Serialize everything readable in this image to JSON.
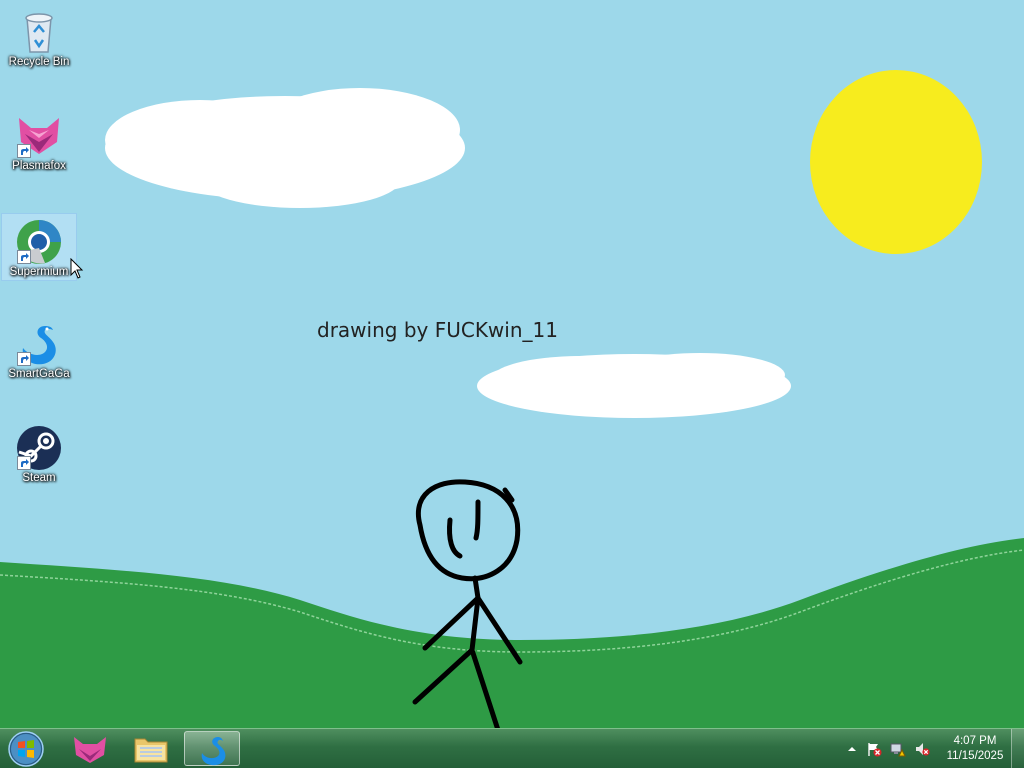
{
  "wallpaper": {
    "caption": "drawing by FUCKwin_11",
    "colors": {
      "sky": "#9dd8ea",
      "sun": "#f7ec1e",
      "cloud": "#ffffff",
      "grass": "#2e9b45",
      "stick_figure": "#000000"
    }
  },
  "desktop_icons": [
    {
      "label": "Recycle Bin",
      "icon": "recycle-bin-icon"
    },
    {
      "label": "Plasmafox",
      "icon": "plasmafox-icon"
    },
    {
      "label": "Supermium",
      "icon": "supermium-icon",
      "selected": true
    },
    {
      "label": "SmartGaGa",
      "icon": "smartgaga-icon"
    },
    {
      "label": "Steam",
      "icon": "steam-icon"
    }
  ],
  "taskbar": {
    "start_icon": "windows-start-orb-icon",
    "pinned": [
      {
        "name": "plasmafox-taskbar",
        "icon": "plasmafox-icon"
      },
      {
        "name": "file-explorer-taskbar",
        "icon": "folder-icon"
      },
      {
        "name": "smartgaga-taskbar",
        "icon": "smartgaga-icon",
        "active": true
      }
    ],
    "tray": {
      "icons": [
        "show-hidden-icons-arrow-icon",
        "action-center-flag-icon",
        "network-icon",
        "volume-muted-icon"
      ],
      "time": "4:07 PM",
      "date": "11/15/2025"
    }
  }
}
